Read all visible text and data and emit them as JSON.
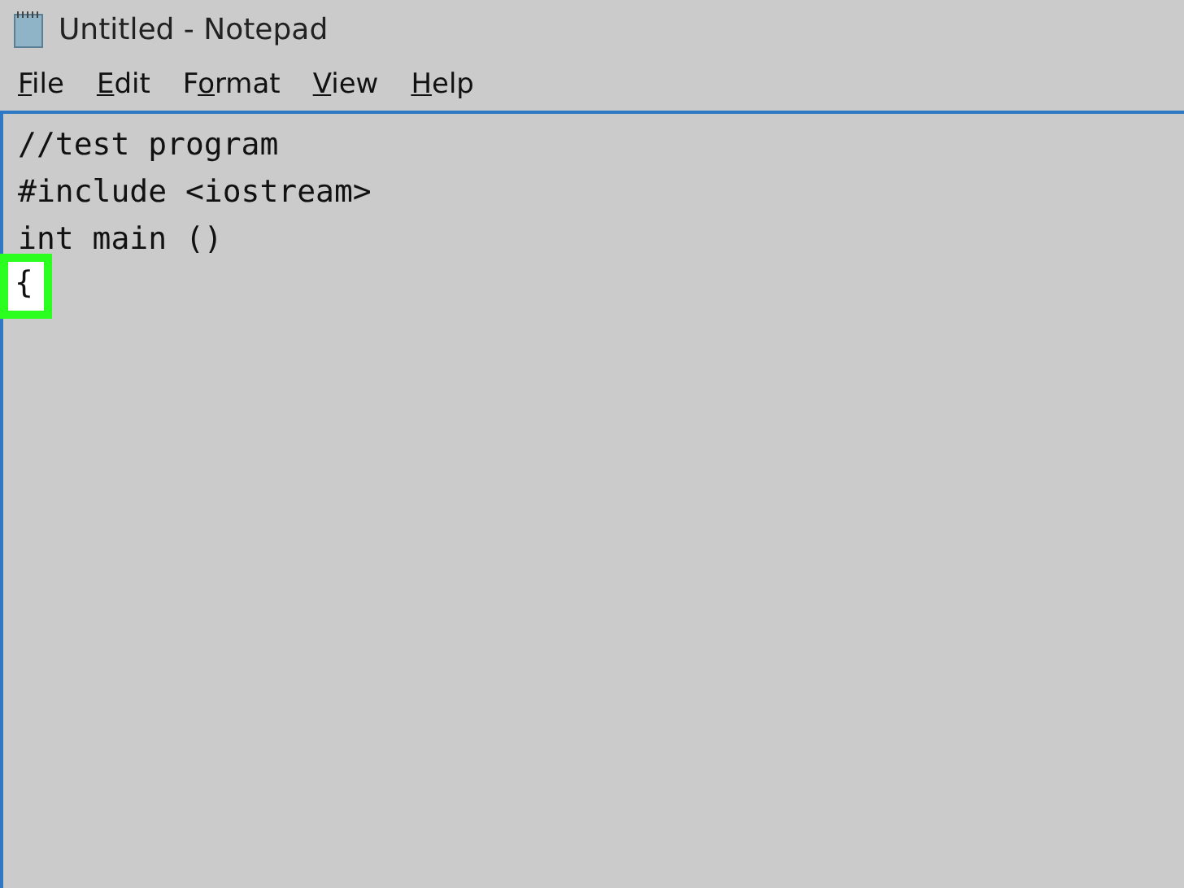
{
  "window": {
    "title": "Untitled - Notepad"
  },
  "menu": [
    {
      "key": "F",
      "after": "ile"
    },
    {
      "key": "E",
      "after": "dit"
    },
    {
      "before": "F",
      "key": "o",
      "after": "rmat"
    },
    {
      "key": "V",
      "after": "iew"
    },
    {
      "key": "H",
      "after": "elp"
    }
  ],
  "editor": {
    "lines": [
      {
        "text": "//test program",
        "highlighted": false
      },
      {
        "text": "#include <iostream>",
        "highlighted": false
      },
      {
        "text": "int main ()",
        "highlighted": false
      },
      {
        "text": "{",
        "highlighted": true
      }
    ]
  }
}
